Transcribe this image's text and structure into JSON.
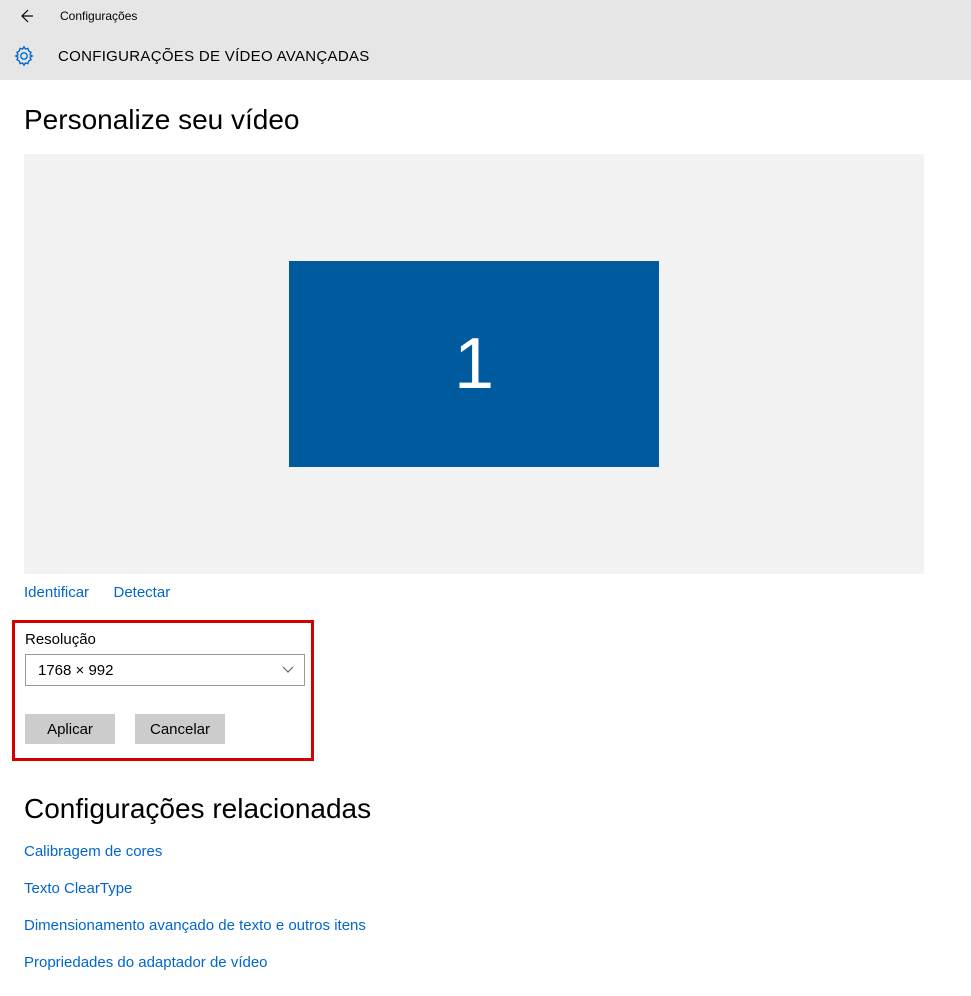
{
  "header": {
    "breadcrumb": "Configurações",
    "page_title": "CONFIGURAÇÕES DE VÍDEO AVANÇADAS"
  },
  "main": {
    "section_title": "Personalize seu vídeo",
    "monitor_number": "1",
    "identify_link": "Identificar",
    "detect_link": "Detectar",
    "resolution_label": "Resolução",
    "resolution_value": "1768 × 992",
    "apply_button": "Aplicar",
    "cancel_button": "Cancelar"
  },
  "related": {
    "title": "Configurações relacionadas",
    "links": [
      "Calibragem de cores",
      "Texto ClearType",
      "Dimensionamento avançado de texto e outros itens",
      "Propriedades do adaptador de vídeo"
    ]
  },
  "colors": {
    "accent": "#005A9E",
    "link": "#0066CC",
    "highlight": "#d40000"
  }
}
